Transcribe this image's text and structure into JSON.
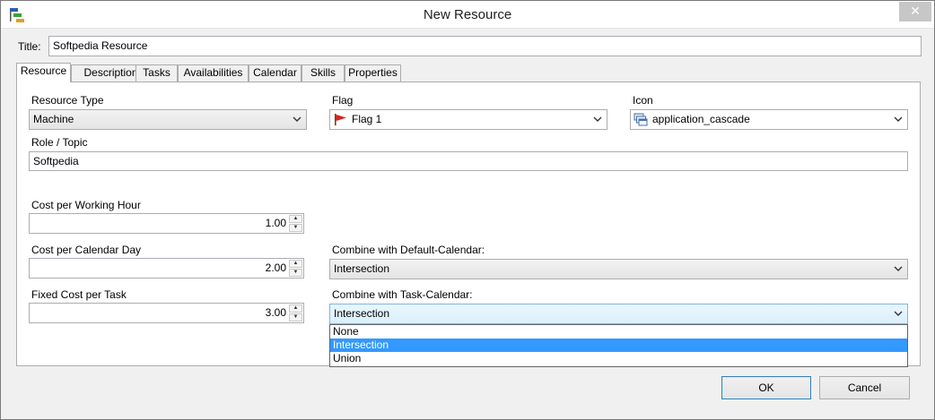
{
  "window": {
    "title": "New Resource",
    "close_symbol": "✕"
  },
  "title_field": {
    "label": "Title:",
    "value": "Softpedia Resource"
  },
  "tabs": [
    {
      "label": "Resource",
      "active": true
    },
    {
      "label": "Description"
    },
    {
      "label": "Tasks"
    },
    {
      "label": "Availabilities"
    },
    {
      "label": "Calendar"
    },
    {
      "label": "Skills"
    },
    {
      "label": "Properties"
    }
  ],
  "resource_tab": {
    "resource_type": {
      "label": "Resource Type",
      "value": "Machine"
    },
    "flag": {
      "label": "Flag",
      "value": "Flag 1",
      "icon": "red-flag-icon",
      "color": "#e02020"
    },
    "icon": {
      "label": "Icon",
      "value": "application_cascade",
      "icon": "application-cascade-icon"
    },
    "role_topic": {
      "label": "Role / Topic",
      "value": "Softpedia"
    },
    "cost_per_working_hour": {
      "label": "Cost per Working Hour",
      "value": "1.00"
    },
    "cost_per_calendar_day": {
      "label": "Cost per Calendar Day",
      "value": "2.00"
    },
    "fixed_cost_per_task": {
      "label": "Fixed Cost per Task",
      "value": "3.00"
    },
    "combine_default_calendar": {
      "label": "Combine with Default-Calendar:",
      "value": "Intersection"
    },
    "combine_task_calendar": {
      "label": "Combine with Task-Calendar:",
      "value": "Intersection",
      "options": [
        "None",
        "Intersection",
        "Union"
      ],
      "highlighted": "Intersection"
    }
  },
  "buttons": {
    "ok": "OK",
    "cancel": "Cancel"
  },
  "colors": {
    "selection": "#3399ff",
    "focus_border": "#7eb4ea"
  }
}
